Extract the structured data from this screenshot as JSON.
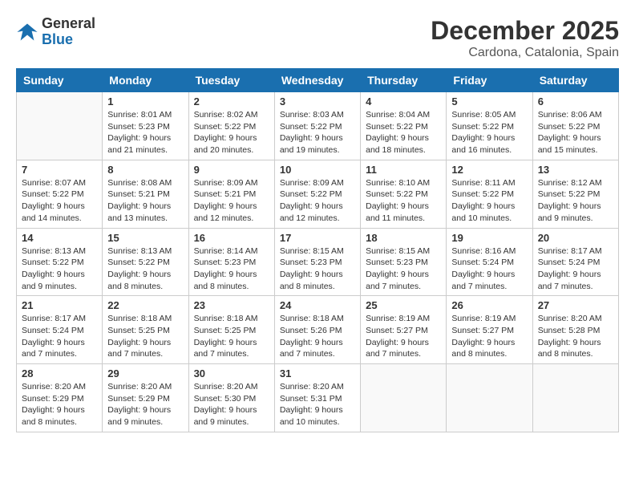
{
  "header": {
    "logo_line1": "General",
    "logo_line2": "Blue",
    "month": "December 2025",
    "location": "Cardona, Catalonia, Spain"
  },
  "weekdays": [
    "Sunday",
    "Monday",
    "Tuesday",
    "Wednesday",
    "Thursday",
    "Friday",
    "Saturday"
  ],
  "weeks": [
    [
      {
        "day": "",
        "info": ""
      },
      {
        "day": "1",
        "info": "Sunrise: 8:01 AM\nSunset: 5:23 PM\nDaylight: 9 hours\nand 21 minutes."
      },
      {
        "day": "2",
        "info": "Sunrise: 8:02 AM\nSunset: 5:22 PM\nDaylight: 9 hours\nand 20 minutes."
      },
      {
        "day": "3",
        "info": "Sunrise: 8:03 AM\nSunset: 5:22 PM\nDaylight: 9 hours\nand 19 minutes."
      },
      {
        "day": "4",
        "info": "Sunrise: 8:04 AM\nSunset: 5:22 PM\nDaylight: 9 hours\nand 18 minutes."
      },
      {
        "day": "5",
        "info": "Sunrise: 8:05 AM\nSunset: 5:22 PM\nDaylight: 9 hours\nand 16 minutes."
      },
      {
        "day": "6",
        "info": "Sunrise: 8:06 AM\nSunset: 5:22 PM\nDaylight: 9 hours\nand 15 minutes."
      }
    ],
    [
      {
        "day": "7",
        "info": "Sunrise: 8:07 AM\nSunset: 5:22 PM\nDaylight: 9 hours\nand 14 minutes."
      },
      {
        "day": "8",
        "info": "Sunrise: 8:08 AM\nSunset: 5:21 PM\nDaylight: 9 hours\nand 13 minutes."
      },
      {
        "day": "9",
        "info": "Sunrise: 8:09 AM\nSunset: 5:21 PM\nDaylight: 9 hours\nand 12 minutes."
      },
      {
        "day": "10",
        "info": "Sunrise: 8:09 AM\nSunset: 5:22 PM\nDaylight: 9 hours\nand 12 minutes."
      },
      {
        "day": "11",
        "info": "Sunrise: 8:10 AM\nSunset: 5:22 PM\nDaylight: 9 hours\nand 11 minutes."
      },
      {
        "day": "12",
        "info": "Sunrise: 8:11 AM\nSunset: 5:22 PM\nDaylight: 9 hours\nand 10 minutes."
      },
      {
        "day": "13",
        "info": "Sunrise: 8:12 AM\nSunset: 5:22 PM\nDaylight: 9 hours\nand 9 minutes."
      }
    ],
    [
      {
        "day": "14",
        "info": "Sunrise: 8:13 AM\nSunset: 5:22 PM\nDaylight: 9 hours\nand 9 minutes."
      },
      {
        "day": "15",
        "info": "Sunrise: 8:13 AM\nSunset: 5:22 PM\nDaylight: 9 hours\nand 8 minutes."
      },
      {
        "day": "16",
        "info": "Sunrise: 8:14 AM\nSunset: 5:23 PM\nDaylight: 9 hours\nand 8 minutes."
      },
      {
        "day": "17",
        "info": "Sunrise: 8:15 AM\nSunset: 5:23 PM\nDaylight: 9 hours\nand 8 minutes."
      },
      {
        "day": "18",
        "info": "Sunrise: 8:15 AM\nSunset: 5:23 PM\nDaylight: 9 hours\nand 7 minutes."
      },
      {
        "day": "19",
        "info": "Sunrise: 8:16 AM\nSunset: 5:24 PM\nDaylight: 9 hours\nand 7 minutes."
      },
      {
        "day": "20",
        "info": "Sunrise: 8:17 AM\nSunset: 5:24 PM\nDaylight: 9 hours\nand 7 minutes."
      }
    ],
    [
      {
        "day": "21",
        "info": "Sunrise: 8:17 AM\nSunset: 5:24 PM\nDaylight: 9 hours\nand 7 minutes."
      },
      {
        "day": "22",
        "info": "Sunrise: 8:18 AM\nSunset: 5:25 PM\nDaylight: 9 hours\nand 7 minutes."
      },
      {
        "day": "23",
        "info": "Sunrise: 8:18 AM\nSunset: 5:25 PM\nDaylight: 9 hours\nand 7 minutes."
      },
      {
        "day": "24",
        "info": "Sunrise: 8:18 AM\nSunset: 5:26 PM\nDaylight: 9 hours\nand 7 minutes."
      },
      {
        "day": "25",
        "info": "Sunrise: 8:19 AM\nSunset: 5:27 PM\nDaylight: 9 hours\nand 7 minutes."
      },
      {
        "day": "26",
        "info": "Sunrise: 8:19 AM\nSunset: 5:27 PM\nDaylight: 9 hours\nand 8 minutes."
      },
      {
        "day": "27",
        "info": "Sunrise: 8:20 AM\nSunset: 5:28 PM\nDaylight: 9 hours\nand 8 minutes."
      }
    ],
    [
      {
        "day": "28",
        "info": "Sunrise: 8:20 AM\nSunset: 5:29 PM\nDaylight: 9 hours\nand 8 minutes."
      },
      {
        "day": "29",
        "info": "Sunrise: 8:20 AM\nSunset: 5:29 PM\nDaylight: 9 hours\nand 9 minutes."
      },
      {
        "day": "30",
        "info": "Sunrise: 8:20 AM\nSunset: 5:30 PM\nDaylight: 9 hours\nand 9 minutes."
      },
      {
        "day": "31",
        "info": "Sunrise: 8:20 AM\nSunset: 5:31 PM\nDaylight: 9 hours\nand 10 minutes."
      },
      {
        "day": "",
        "info": ""
      },
      {
        "day": "",
        "info": ""
      },
      {
        "day": "",
        "info": ""
      }
    ]
  ]
}
